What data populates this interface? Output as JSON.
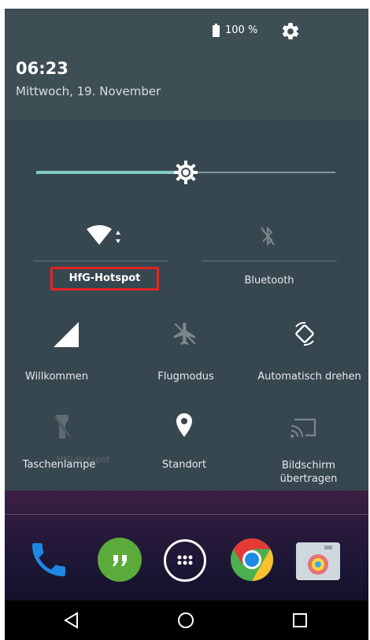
{
  "status": {
    "battery_text": "100 %",
    "battery_icon": "battery-full-icon",
    "settings_icon": "gear-icon"
  },
  "header": {
    "time": "06:23",
    "date": "Mittwoch, 19. November"
  },
  "brightness": {
    "level_percent": 50,
    "accent": "#80cbc4"
  },
  "tiles": {
    "wifi": {
      "label": "HfG-Hotspot",
      "icon": "wifi-icon",
      "highlight_color": "#e02424"
    },
    "bluetooth": {
      "label": "Bluetooth",
      "icon": "bluetooth-off-icon"
    },
    "signal": {
      "label": "Willkommen",
      "icon": "signal-icon"
    },
    "airplane": {
      "label": "Flugmodus",
      "icon": "airplane-icon"
    },
    "rotate": {
      "label": "Automatisch drehen",
      "icon": "rotate-icon"
    },
    "flashlight": {
      "label": "Taschenlampe",
      "icon": "flashlight-off-icon"
    },
    "location": {
      "label": "Standort",
      "icon": "location-pin-icon"
    },
    "cast": {
      "label_line1": "Bildschirm",
      "label_line2": "übertragen",
      "icon": "cast-icon"
    }
  },
  "ghost_text": "HfG-Hotspot",
  "dock": [
    {
      "name": "phone-app-icon"
    },
    {
      "name": "hangouts-app-icon"
    },
    {
      "name": "app-drawer-icon"
    },
    {
      "name": "chrome-app-icon"
    },
    {
      "name": "camera-app-icon"
    }
  ],
  "nav": {
    "back": "back-icon",
    "home": "home-icon",
    "recents": "recents-icon"
  }
}
